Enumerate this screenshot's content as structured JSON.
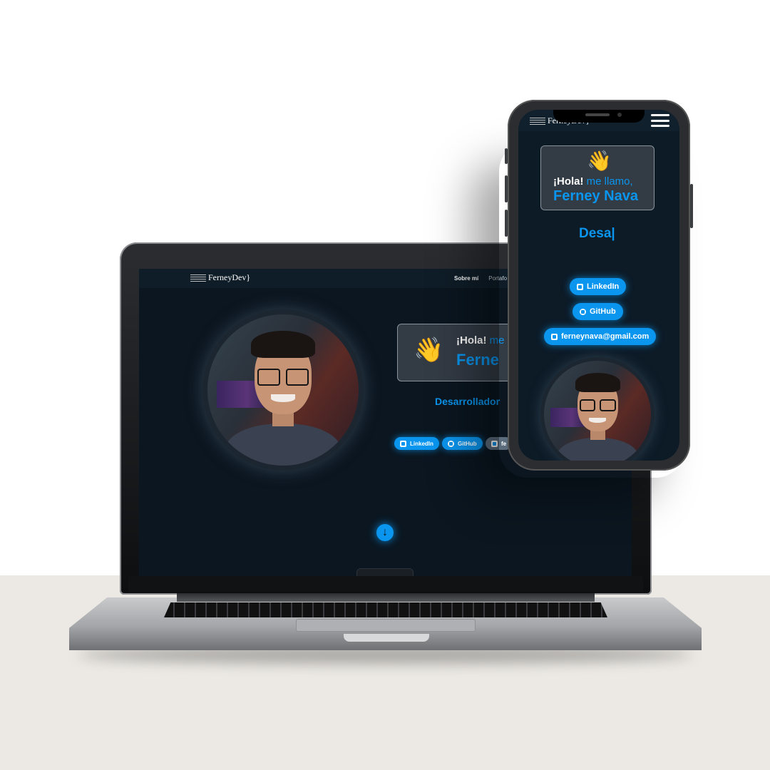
{
  "brand": {
    "logo_text": "FerneyDev}"
  },
  "nav": {
    "items": [
      "Sobre mí",
      "Portafo"
    ]
  },
  "hero": {
    "wave_emoji": "👋",
    "greeting_hello": "¡Hola!",
    "greeting_rest_laptop": "me",
    "greeting_rest_phone": "me llamo,",
    "name_laptop": "Ferne",
    "name_phone": "Ferney Nava",
    "role_laptop": "Desarrollador",
    "role_phone": "Desa|"
  },
  "social": {
    "linkedin": "LinkedIn",
    "github": "GitHub",
    "email_laptop": "fe",
    "email_phone": "ferneynava@gmail.com"
  },
  "scroll_down_icon": "↓",
  "colors": {
    "accent": "#0a95ee",
    "background": "#0b1620",
    "card": "#333b45"
  }
}
